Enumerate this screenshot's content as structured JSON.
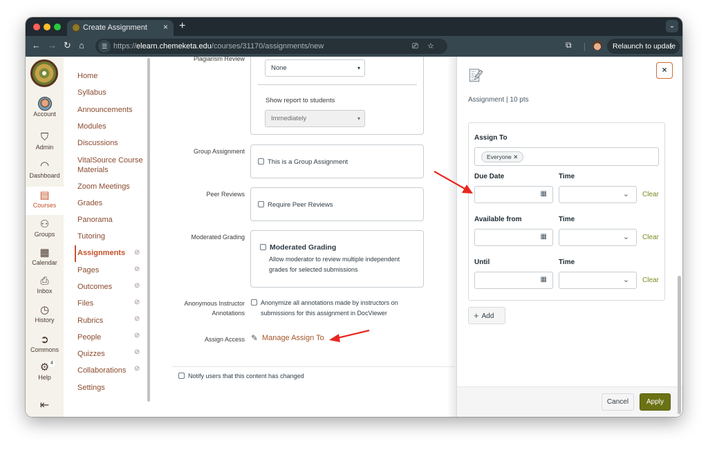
{
  "browser": {
    "tab_title": "Create Assignment",
    "tab_close": "×",
    "new_tab": "+",
    "url_prefix": "https://",
    "url_host": "elearn.chemeketa.edu",
    "url_path": "/courses/31170/assignments/new",
    "relaunch_label": "Relaunch to update",
    "relaunch_menu": "⋮"
  },
  "global_nav": {
    "items": [
      {
        "label": "Account",
        "icon": "avatar"
      },
      {
        "label": "Admin",
        "icon": "shield-icon"
      },
      {
        "label": "Dashboard",
        "icon": "dashboard-icon"
      },
      {
        "label": "Courses",
        "icon": "book-icon",
        "active": true
      },
      {
        "label": "Groups",
        "icon": "groups-icon"
      },
      {
        "label": "Calendar",
        "icon": "calendar-icon"
      },
      {
        "label": "Inbox",
        "icon": "inbox-icon"
      },
      {
        "label": "History",
        "icon": "clock-icon"
      },
      {
        "label": "Commons",
        "icon": "commons-icon"
      },
      {
        "label": "Help",
        "icon": "gear-icon",
        "badge": "4"
      }
    ],
    "collapse_icon": "⇤"
  },
  "course_nav": {
    "items": [
      {
        "label": "Home"
      },
      {
        "label": "Syllabus"
      },
      {
        "label": "Announcements"
      },
      {
        "label": "Modules"
      },
      {
        "label": "Discussions"
      },
      {
        "label": "VitalSource Course",
        "label2": "Materials"
      },
      {
        "label": "Zoom Meetings"
      },
      {
        "label": "Grades"
      },
      {
        "label": "Panorama"
      },
      {
        "label": "Tutoring"
      },
      {
        "label": "Assignments",
        "active": true,
        "hidden": true
      },
      {
        "label": "Pages",
        "hidden": true
      },
      {
        "label": "Outcomes",
        "hidden": true
      },
      {
        "label": "Files",
        "hidden": true
      },
      {
        "label": "Rubrics",
        "hidden": true
      },
      {
        "label": "People",
        "hidden": true
      },
      {
        "label": "Quizzes",
        "hidden": true
      },
      {
        "label": "Collaborations",
        "hidden": true
      },
      {
        "label": "Settings"
      }
    ]
  },
  "form": {
    "plagiarism_label": "Plagiarism Review",
    "plagiarism_value": "None",
    "show_report_label": "Show report to students",
    "show_report_value": "Immediately",
    "group_label": "Group Assignment",
    "group_checkbox": "This is a Group Assignment",
    "peer_label": "Peer Reviews",
    "peer_checkbox": "Require Peer Reviews",
    "moderated_label": "Moderated Grading",
    "moderated_checkbox": "Moderated Grading",
    "moderated_desc1": "Allow moderator to review multiple independent",
    "moderated_desc2": "grades for selected submissions",
    "anon_label1": "Anonymous Instructor",
    "anon_label2": "Annotations",
    "anon_text1": "Anonymize all annotations made by instructors on",
    "anon_text2": "submissions for this assignment in DocViewer",
    "assign_access_label": "Assign Access",
    "manage_assign_link": "Manage Assign To",
    "notify_text": "Notify users that this content has changed"
  },
  "tray": {
    "close_label": "×",
    "subtitle": "Assignment | 10 pts",
    "assign_to_label": "Assign To",
    "assign_to_pill": "Everyone",
    "pill_remove": "✕",
    "rows": [
      {
        "date_label": "Due Date",
        "time_label": "Time",
        "date_value": "",
        "time_value": "",
        "clear_label": "Clear"
      },
      {
        "date_label": "Available from",
        "time_label": "Time",
        "date_value": "",
        "time_value": "",
        "clear_label": "Clear"
      },
      {
        "date_label": "Until",
        "time_label": "Time",
        "date_value": "",
        "time_value": "",
        "clear_label": "Clear"
      }
    ],
    "add_label": "Add",
    "cancel_label": "Cancel",
    "apply_label": "Apply"
  },
  "colors": {
    "brand": "#c4512a",
    "link": "#a4552a",
    "apply": "#6b7214",
    "clear": "#7a8a1e",
    "annotation_arrow": "#e8261f"
  }
}
